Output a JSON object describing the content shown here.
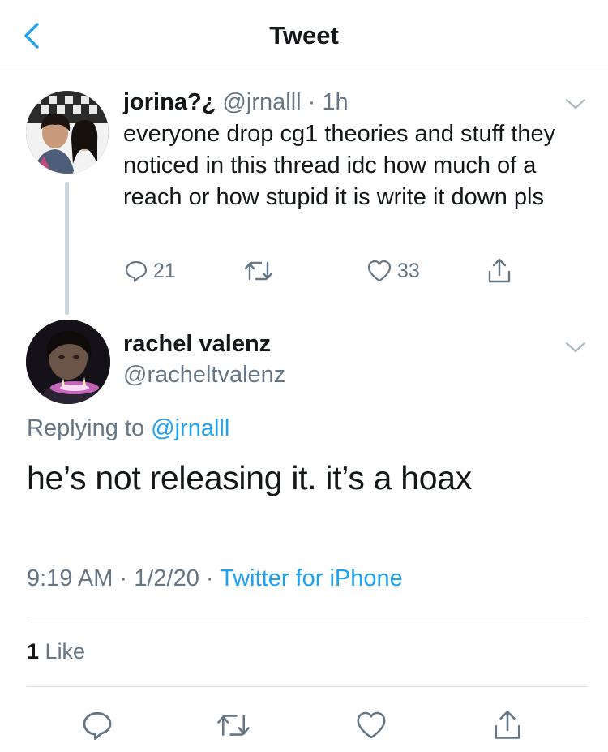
{
  "header": {
    "title": "Tweet",
    "back_icon": "chevron-left-icon",
    "accent": "#1da1f2"
  },
  "parent_tweet": {
    "name": "jorina?¿",
    "handle": "@jrnalll",
    "separator": "·",
    "time": "1h",
    "text": "everyone drop cg1 theories and stuff they noticed in this thread idc how much of a reach or how stupid it is write it down pls",
    "reply_count": "21",
    "like_count": "33"
  },
  "main_tweet": {
    "name": "rachel valenz",
    "handle": "@racheltvalenz",
    "replying_prefix": "Replying to",
    "replying_to": "@jrnalll",
    "text": "he’s not releasing it. it’s a hoax",
    "time": "9:19 AM",
    "separator": "·",
    "date": "1/2/20",
    "source": "Twitter for iPhone"
  },
  "stats": {
    "like_count": "1",
    "like_label": "Like"
  },
  "icons": [
    "reply-icon",
    "retweet-icon",
    "like-icon",
    "share-icon"
  ]
}
